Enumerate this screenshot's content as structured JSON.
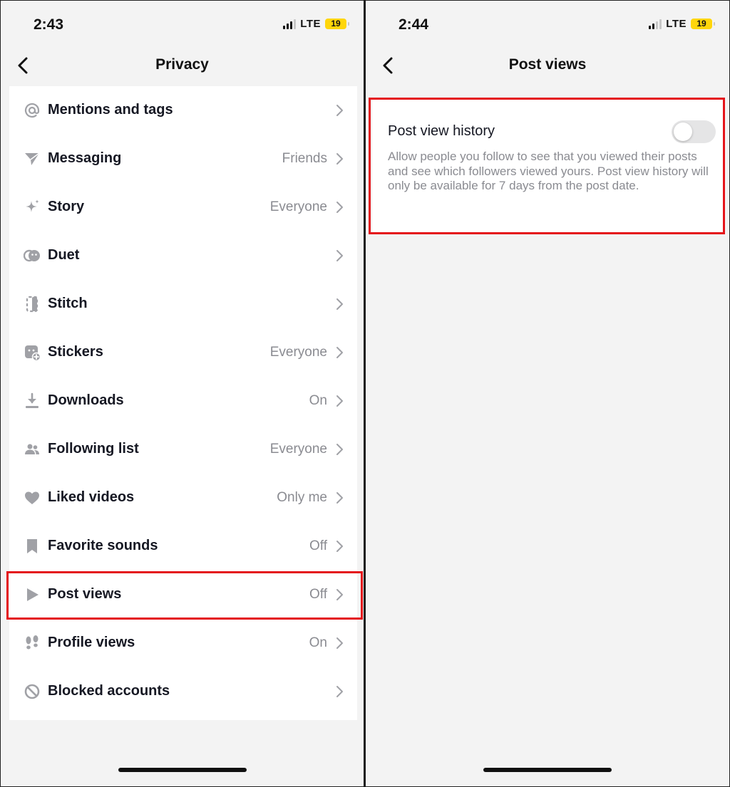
{
  "left_screen": {
    "status": {
      "time": "2:43",
      "network": "LTE",
      "battery": "19"
    },
    "nav": {
      "title": "Privacy"
    },
    "menu": [
      {
        "label": "Mentions and tags",
        "value": "",
        "icon": "at-icon"
      },
      {
        "label": "Messaging",
        "value": "Friends",
        "icon": "send-icon"
      },
      {
        "label": "Story",
        "value": "Everyone",
        "icon": "sparkle-icon"
      },
      {
        "label": "Duet",
        "value": "",
        "icon": "duet-icon"
      },
      {
        "label": "Stitch",
        "value": "",
        "icon": "stitch-icon"
      },
      {
        "label": "Stickers",
        "value": "Everyone",
        "icon": "sticker-icon"
      },
      {
        "label": "Downloads",
        "value": "On",
        "icon": "download-icon"
      },
      {
        "label": "Following list",
        "value": "Everyone",
        "icon": "people-icon"
      },
      {
        "label": "Liked videos",
        "value": "Only me",
        "icon": "heart-icon"
      },
      {
        "label": "Favorite sounds",
        "value": "Off",
        "icon": "bookmark-icon"
      },
      {
        "label": "Post views",
        "value": "Off",
        "icon": "play-icon"
      },
      {
        "label": "Profile views",
        "value": "On",
        "icon": "footprints-icon"
      },
      {
        "label": "Blocked accounts",
        "value": "",
        "icon": "block-icon"
      }
    ]
  },
  "right_screen": {
    "status": {
      "time": "2:44",
      "network": "LTE",
      "battery": "19"
    },
    "nav": {
      "title": "Post views"
    },
    "setting": {
      "title": "Post view history",
      "description": "Allow people you follow to see that you viewed their posts and see which followers viewed yours. Post view history will only be available for 7 days from the post date.",
      "toggle_on": false
    }
  },
  "colors": {
    "highlight": "#e4131a",
    "battery": "#ffd60a",
    "background": "#f3f3f3",
    "secondary_text": "#8a8b91"
  }
}
